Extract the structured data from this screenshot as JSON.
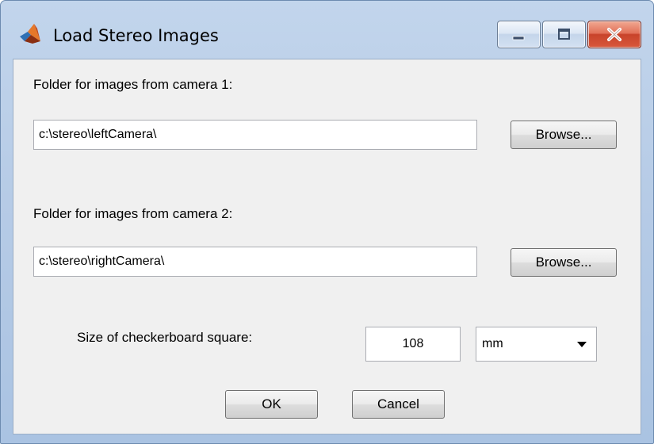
{
  "window": {
    "title": "Load Stereo Images",
    "icons": {
      "app": "matlab-logo-icon",
      "minimize": "minimize-icon",
      "maximize": "maximize-icon",
      "close": "close-icon"
    }
  },
  "camera1": {
    "label": "Folder for images from camera 1:",
    "path": "c:\\stereo\\leftCamera\\",
    "browse_label": "Browse..."
  },
  "camera2": {
    "label": "Folder for images from camera 2:",
    "path": "c:\\stereo\\rightCamera\\",
    "browse_label": "Browse..."
  },
  "checkerboard": {
    "label": "Size of checkerboard square:",
    "value": "108",
    "unit": "mm"
  },
  "actions": {
    "ok_label": "OK",
    "cancel_label": "Cancel"
  },
  "colors": {
    "frame": "#b6cbe6",
    "close_button": "#c8432a",
    "client_background": "#f0f0f0"
  }
}
